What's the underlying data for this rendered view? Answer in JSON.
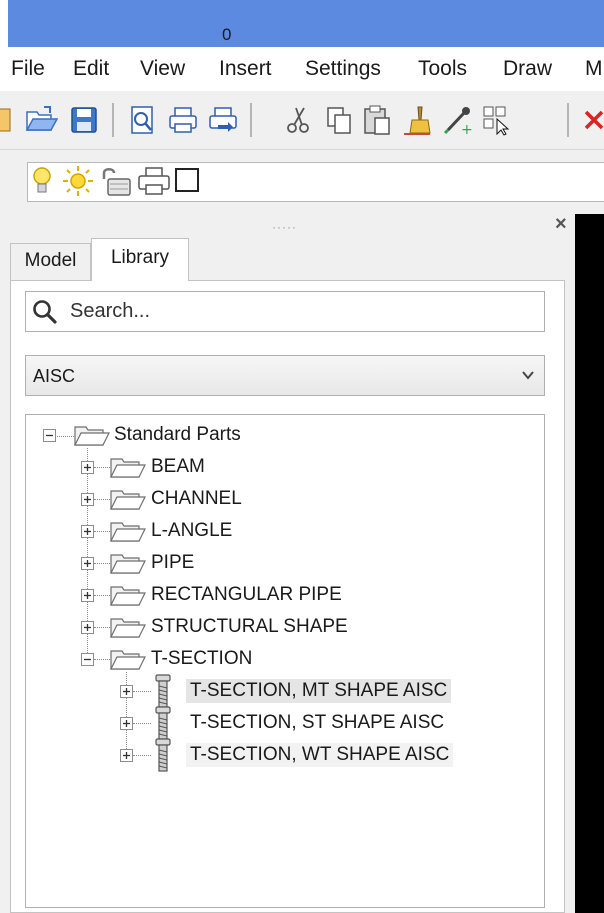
{
  "menu": {
    "items": [
      "File",
      "Edit",
      "View",
      "Insert",
      "Settings",
      "Tools",
      "Draw",
      "M"
    ]
  },
  "layer_bar": {
    "layer_name": "0"
  },
  "panel": {
    "tabs": [
      "Model",
      "Library"
    ],
    "active_tab": "Library",
    "search_placeholder": "Search...",
    "library_select": "AISC"
  },
  "tree": {
    "root": "Standard Parts",
    "folders": [
      "BEAM",
      "CHANNEL",
      "L-ANGLE",
      "PIPE",
      "RECTANGULAR PIPE",
      "STRUCTURAL SHAPE",
      "T-SECTION"
    ],
    "tsection_items": [
      "T-SECTION, MT SHAPE AISC",
      "T-SECTION, ST SHAPE AISC",
      "T-SECTION, WT SHAPE AISC"
    ],
    "selected": "T-SECTION, MT SHAPE AISC"
  },
  "colors": {
    "title_bar": "#5b8ae0",
    "drawing_area": "#000000"
  }
}
